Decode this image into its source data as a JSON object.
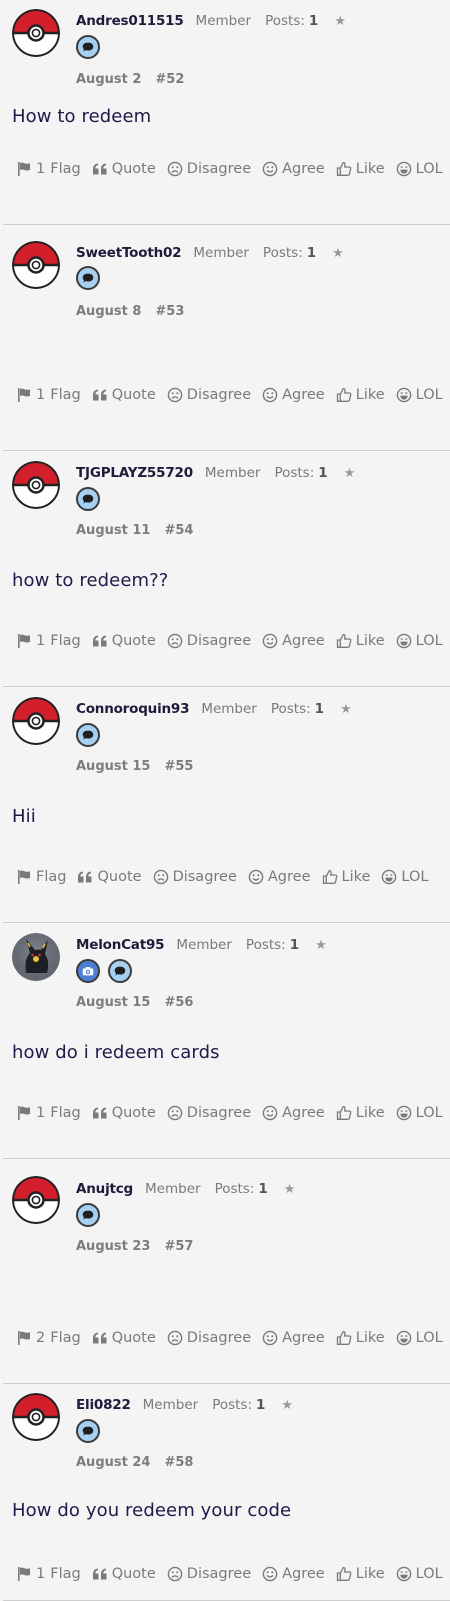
{
  "actions": {
    "flag": "Flag",
    "quote": "Quote",
    "disagree": "Disagree",
    "agree": "Agree",
    "like": "Like",
    "lol": "LOL"
  },
  "posts": [
    {
      "username": "Andres011515",
      "role": "Member",
      "posts_label": "Posts:",
      "posts_count": "1",
      "date": "August 2",
      "post_number": "#52",
      "body": "How to redeem",
      "flag_count": "1",
      "avatar": "pokeball-avatar",
      "badges": [
        "speech-bubble-badge"
      ]
    },
    {
      "username": "SweetTooth02",
      "role": "Member",
      "posts_label": "Posts:",
      "posts_count": "1",
      "date": "August 8",
      "post_number": "#53",
      "body": "",
      "flag_count": "1",
      "avatar": "pokeball-avatar",
      "badges": [
        "speech-bubble-badge"
      ]
    },
    {
      "username": "TJGPLAYZ55720",
      "role": "Member",
      "posts_label": "Posts:",
      "posts_count": "1",
      "date": "August 11",
      "post_number": "#54",
      "body": "how to redeem??",
      "flag_count": "1",
      "avatar": "pokeball-avatar",
      "badges": [
        "speech-bubble-badge"
      ]
    },
    {
      "username": "Connoroquin93",
      "role": "Member",
      "posts_label": "Posts:",
      "posts_count": "1",
      "date": "August 15",
      "post_number": "#55",
      "body": "Hii",
      "flag_count": "",
      "avatar": "pokeball-avatar",
      "badges": [
        "speech-bubble-badge"
      ]
    },
    {
      "username": "MelonCat95",
      "role": "Member",
      "posts_label": "Posts:",
      "posts_count": "1",
      "date": "August 15",
      "post_number": "#56",
      "body": "how do i redeem cards",
      "flag_count": "1",
      "avatar": "umbreon-avatar",
      "badges": [
        "camera-badge",
        "speech-bubble-badge"
      ]
    },
    {
      "username": "Anujtcg",
      "role": "Member",
      "posts_label": "Posts:",
      "posts_count": "1",
      "date": "August 23",
      "post_number": "#57",
      "body": "",
      "flag_count": "2",
      "avatar": "pokeball-avatar",
      "badges": [
        "speech-bubble-badge"
      ]
    },
    {
      "username": "Eli0822",
      "role": "Member",
      "posts_label": "Posts:",
      "posts_count": "1",
      "date": "August 24",
      "post_number": "#58",
      "body": "How do you redeem your code",
      "flag_count": "1",
      "avatar": "pokeball-avatar",
      "badges": [
        "speech-bubble-badge"
      ]
    }
  ]
}
